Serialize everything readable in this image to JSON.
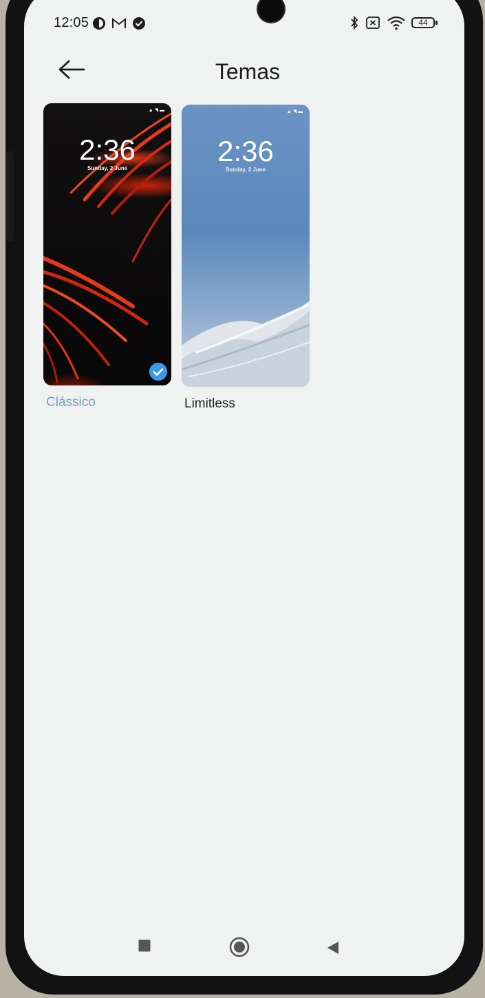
{
  "status_bar": {
    "time": "12:05",
    "battery": "44",
    "left_icons": [
      "data-saver-icon",
      "gmail-icon",
      "check-circle-icon"
    ],
    "right_icons": [
      "bluetooth-icon",
      "no-sim-icon",
      "wifi-icon",
      "battery-icon"
    ]
  },
  "header": {
    "title": "Temas",
    "back_icon": "back-arrow-icon"
  },
  "themes": [
    {
      "name": "Clássico",
      "preview_time": "2:36",
      "preview_date": "Sunday, 2 June",
      "selected": true
    },
    {
      "name": "Limitless",
      "preview_time": "2:36",
      "preview_date": "Sunday, 2 June",
      "selected": false
    }
  ],
  "nav_bar": {
    "items": [
      "recents-button",
      "home-button",
      "back-button"
    ]
  },
  "colors": {
    "screen_background": "#f0f1f1",
    "selected_accent": "#3a9ae8",
    "selected_label": "#6ea2c8"
  }
}
